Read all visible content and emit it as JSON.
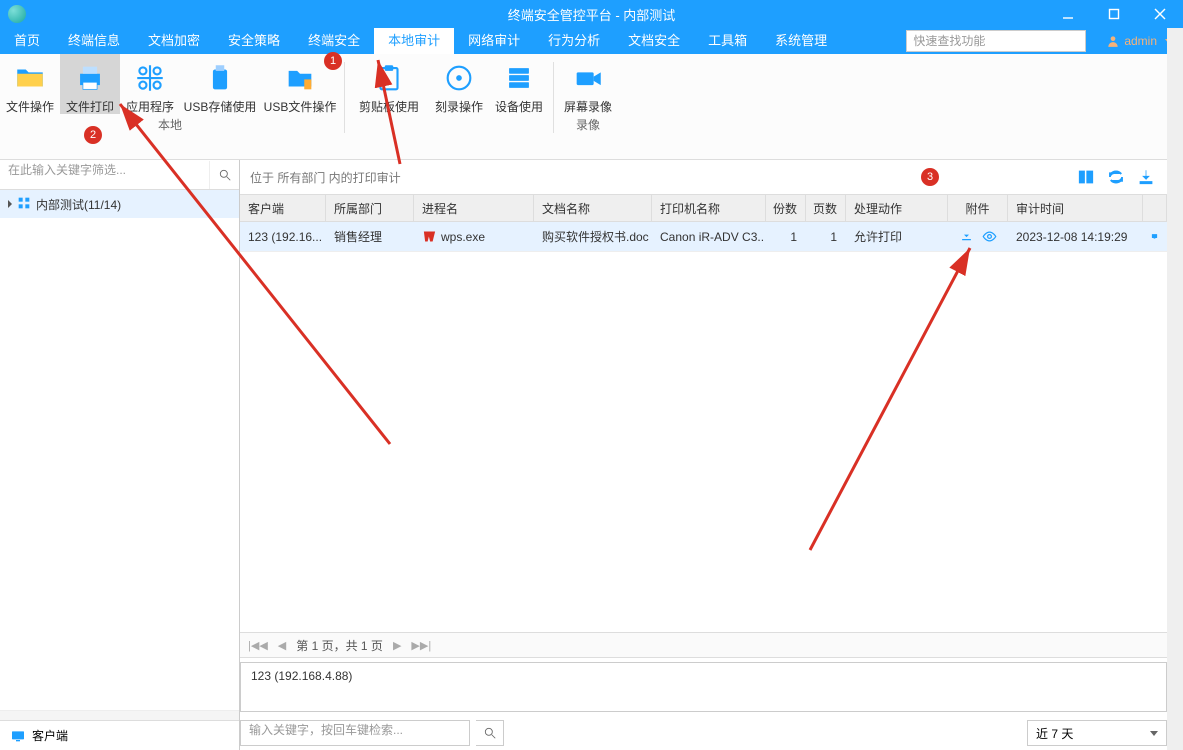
{
  "window_title": "终端安全管控平台 - 内部测试",
  "menubar": [
    "首页",
    "终端信息",
    "文档加密",
    "安全策略",
    "终端安全",
    "本地审计",
    "网络审计",
    "行为分析",
    "文档安全",
    "工具箱",
    "系统管理"
  ],
  "active_menu_index": 5,
  "search_placeholder": "快速查找功能",
  "user_label": "admin",
  "ribbon_group1": [
    "文件操作",
    "文件打印",
    "应用程序",
    "USB存储使用",
    "USB文件操作"
  ],
  "ribbon_group1_label": "本地",
  "ribbon_group2": [
    "剪贴板使用",
    "刻录操作",
    "设备使用"
  ],
  "ribbon_group3": [
    "屏幕录像"
  ],
  "ribbon_group3_label": "录像",
  "left_filter_placeholder": "在此输入关键字筛选...",
  "tree_root": "内部测试(11/14)",
  "left_bottom": "客户端",
  "loc_text": "位于 所有部门 内的打印审计",
  "columns": [
    "客户端",
    "所属部门",
    "进程名",
    "文档名称",
    "打印机名称",
    "份数",
    "页数",
    "处理动作",
    "附件",
    "审计时间"
  ],
  "row": {
    "client": "123 (192.16...",
    "dept": "销售经理",
    "proc": "wps.exe",
    "doc": "购买软件授权书.doc",
    "printer": "Canon iR-ADV C3...",
    "copies": "1",
    "pages": "1",
    "action": "允许打印",
    "time": "2023-12-08 14:19:29"
  },
  "pager_text": "第 1 页，共 1 页",
  "detail_text": "123 (192.168.4.88)",
  "keyword_placeholder": "输入关键字，按回车键检索...",
  "range_label": "近 7 天",
  "badges": {
    "1": "1",
    "2": "2",
    "3": "3"
  }
}
